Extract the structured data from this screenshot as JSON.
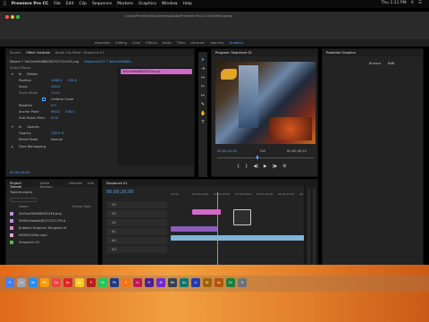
{
  "menu": {
    "apple": "",
    "app": "Premiere Pro CC",
    "items": [
      "File",
      "Edit",
      "Clip",
      "Sequence",
      "Markers",
      "Graphics",
      "Window",
      "Help"
    ]
  },
  "system": {
    "time": "Thu 1:11 PM"
  },
  "path_text": "/Users/Premiere/Documents/Adobe/Premiere Pro/11.0/Untitled.prproj",
  "workspaces": {
    "items": [
      "Assembly",
      "Editing",
      "Color",
      "Effects",
      "Audio",
      "Titles",
      "Libraries",
      "Learning",
      "Graphics"
    ],
    "active": "Graphics"
  },
  "source_panel": {
    "tabs": [
      "Effect Controls",
      "Audio Clip Mixer: Sequence 01"
    ],
    "source_line": "Master * 3e01ee9fe68826231272c7c9.png",
    "sequence_line": "Sequence 01 * 3e01ee9fe68...",
    "video_effects": "Video Effects",
    "motion": "Motion",
    "position_label": "Position",
    "position_x": "1280.0",
    "position_y": "720.0",
    "scale_label": "Scale",
    "scale_value": "100.0",
    "scale_width_label": "Scale Width",
    "uniform_scale": "Uniform Scale",
    "rotation_label": "Rotation",
    "rotation_value": "0.0",
    "anchor_label": "Anchor Point",
    "anchor_x": "960.0",
    "anchor_y": "540.0",
    "antiflicker_label": "Anti-flicker Filter",
    "antiflicker_value": "0.00",
    "opacity_label": "Opacity",
    "opacity_value": "100.0 %",
    "blend_label": "Blend Mode",
    "blend_value": "Normal",
    "time_remap": "Time Remapping",
    "timecode": "00:00:20:00",
    "clip_label": "3e01ee9fe688262316.png"
  },
  "program_panel": {
    "title": "Program: Sequence 01",
    "timecode_left": "00;00;20;00",
    "timecode_right": "00;00;40;10",
    "fit": "Full"
  },
  "essential_graphics": {
    "title": "Essential Graphics",
    "tabs": [
      "Browse",
      "Edit"
    ],
    "active_tab": "Edit"
  },
  "project_panel": {
    "tabs": [
      "Project: Tutorial",
      "Media Browser",
      "Libraries",
      "Info"
    ],
    "project_name": "Tutorial.prproj",
    "columns": [
      "Name",
      "Frame Rate"
    ],
    "items": [
      {
        "name": "3e01ee9fe688262316.png",
        "color": "#c58df0"
      },
      {
        "name": "3f490cfabe6c82172311791d",
        "color": "#c58df0"
      },
      {
        "name": "Bubbles Graphics Template M",
        "color": "#e87fd0"
      },
      {
        "name": "WS00410Ssl.mp4",
        "color": "#f4a0d0"
      },
      {
        "name": "Sequence 01",
        "color": "#56b94d"
      }
    ]
  },
  "timeline": {
    "title": "Sequence 01",
    "timecode": "00;00;20;00",
    "ruler": [
      "00;00",
      "00;00;16;00",
      "00;00;32;00",
      "00;00;48;00",
      "00;01;04;00",
      "00;01;20;00",
      "00;01;36;00"
    ],
    "tracks_video": [
      "V3",
      "V2",
      "V1"
    ],
    "tracks_audio": [
      "A1",
      "A2",
      "A3"
    ],
    "master": "Master",
    "master_value": "0.0"
  },
  "dock": {
    "apps": [
      "Finder",
      "Launchpad",
      "Safari",
      "Photos",
      "Calendar",
      "Acrobat",
      "Notes",
      "FileZilla",
      "Chrome",
      "Photoshop",
      "Illustrator",
      "InDesign",
      "Premiere",
      "After Effects",
      "Media Encoder",
      "Audition",
      "Lightroom",
      "Bridge",
      "Animate",
      "Dreamweaver",
      "Trash"
    ]
  },
  "colors": {
    "accent": "#4ea6ff",
    "clip_pink": "#d668c9",
    "clip_blue": "#7fb5d9",
    "clip_green": "#63b05a"
  }
}
